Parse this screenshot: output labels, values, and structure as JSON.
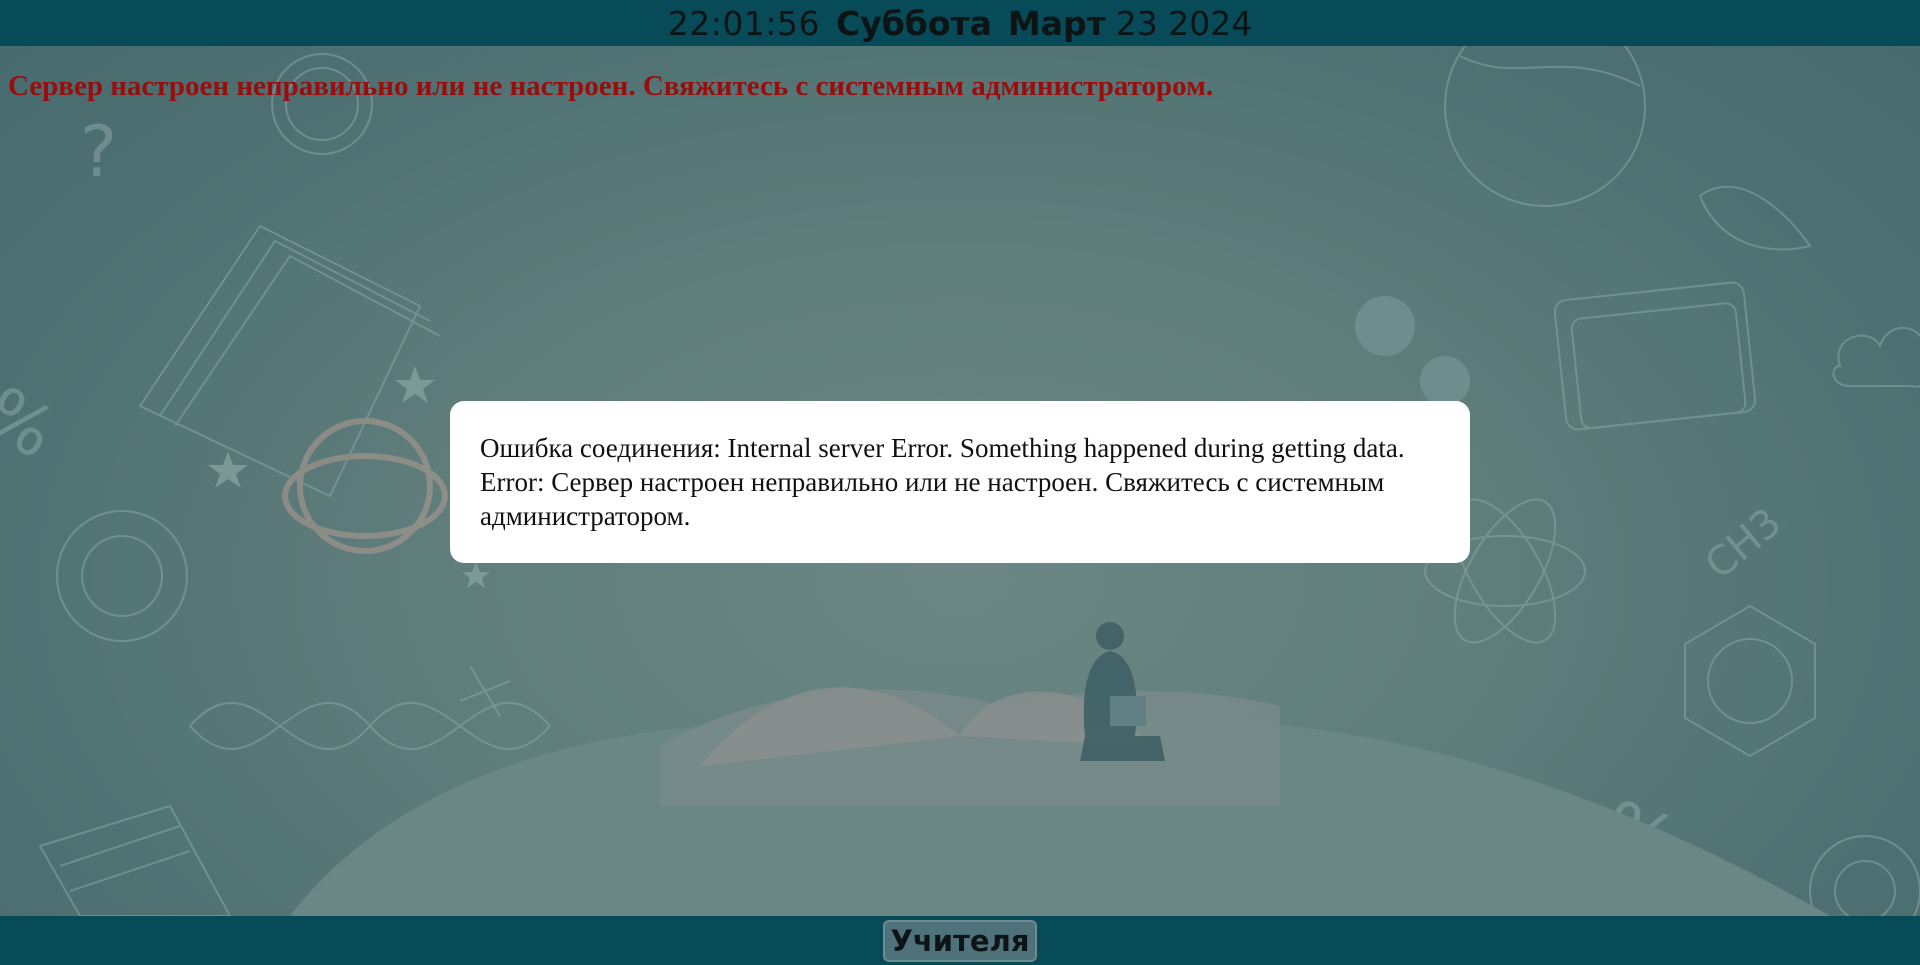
{
  "header": {
    "time": "22:01:56",
    "weekday": "Суббота",
    "month": "Март",
    "day_year": "23 2024"
  },
  "status": {
    "error_message": "Сервер настроен неправильно или не настроен. Свяжитесь с системным администратором."
  },
  "dialog": {
    "message": "Ошибка соединения: Internal server Error. Something happened during getting data. Error: Сервер настроен неправильно или не настроен. Свяжитесь с системным администратором."
  },
  "footer": {
    "teachers_button": "Учителя"
  },
  "colors": {
    "bar_background": "#064b57",
    "page_background": "#5f7d7b",
    "error_text": "#9a0d0d",
    "dialog_background": "#ffffff"
  }
}
